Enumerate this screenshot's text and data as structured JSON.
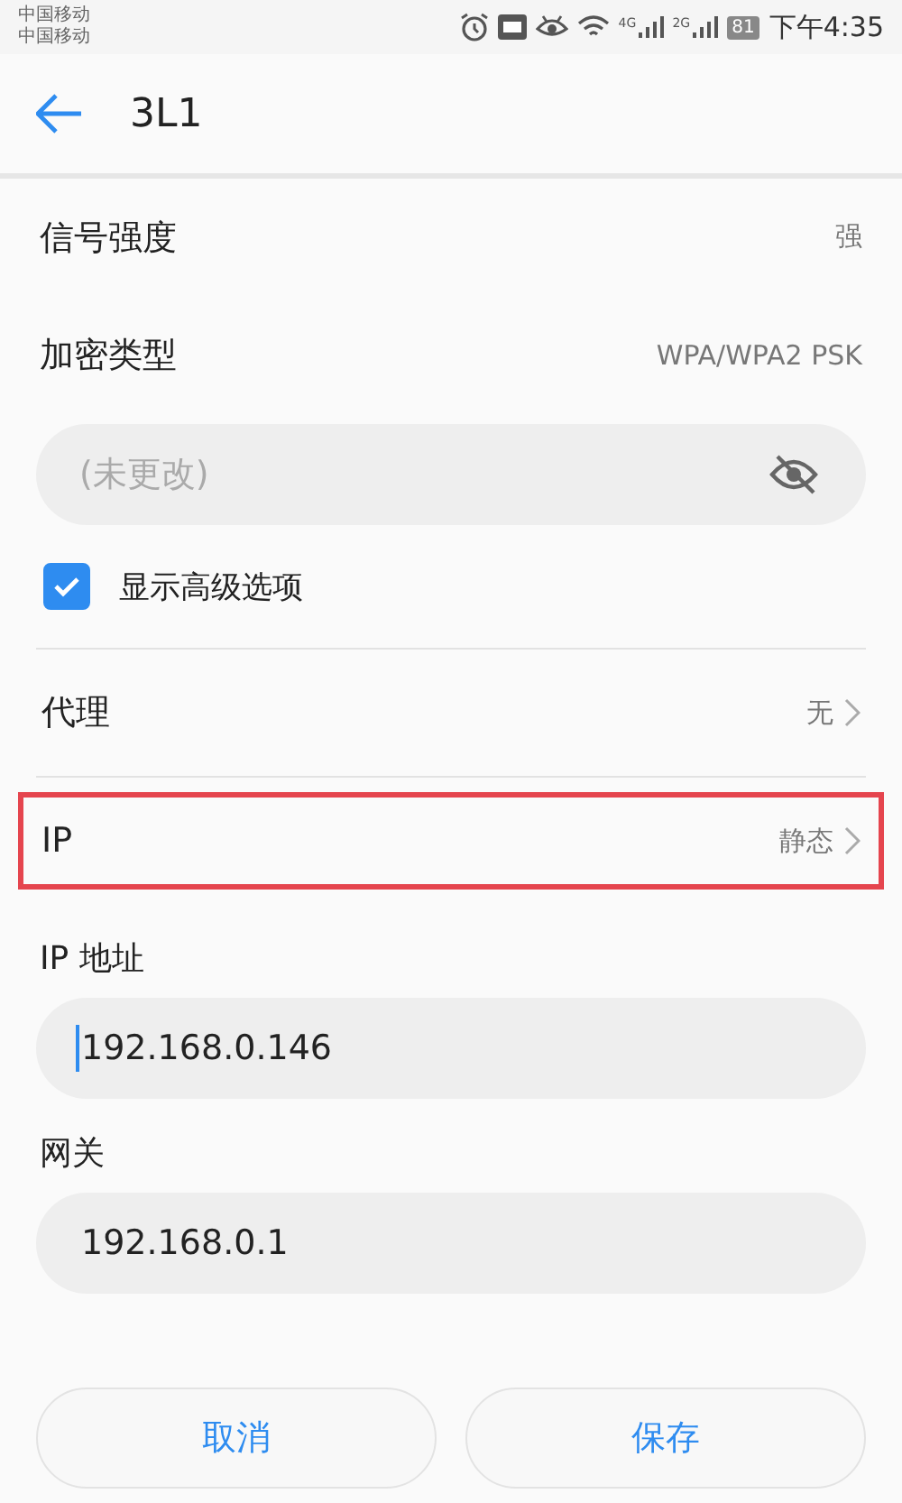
{
  "status_bar": {
    "carriers": [
      "中国移动",
      "中国移动"
    ],
    "network_1": "4G",
    "network_2": "2G",
    "battery": "81",
    "time": "下午4:35"
  },
  "header": {
    "title": "3L1"
  },
  "info_rows": [
    {
      "label": "信号强度",
      "value": "强"
    },
    {
      "label": "加密类型",
      "value": "WPA/WPA2 PSK"
    }
  ],
  "password_field": {
    "placeholder": "(未更改)"
  },
  "advanced_option": {
    "label": "显示高级选项",
    "checked": true
  },
  "setting_rows": [
    {
      "label": "代理",
      "value": "无",
      "highlighted": false
    },
    {
      "label": "IP",
      "value": "静态",
      "highlighted": true
    }
  ],
  "fields": [
    {
      "label": "IP 地址",
      "value": "192.168.0.146",
      "focused": true
    },
    {
      "label": "网关",
      "value": "192.168.0.1",
      "focused": false
    }
  ],
  "buttons": [
    "取消",
    "保存"
  ]
}
